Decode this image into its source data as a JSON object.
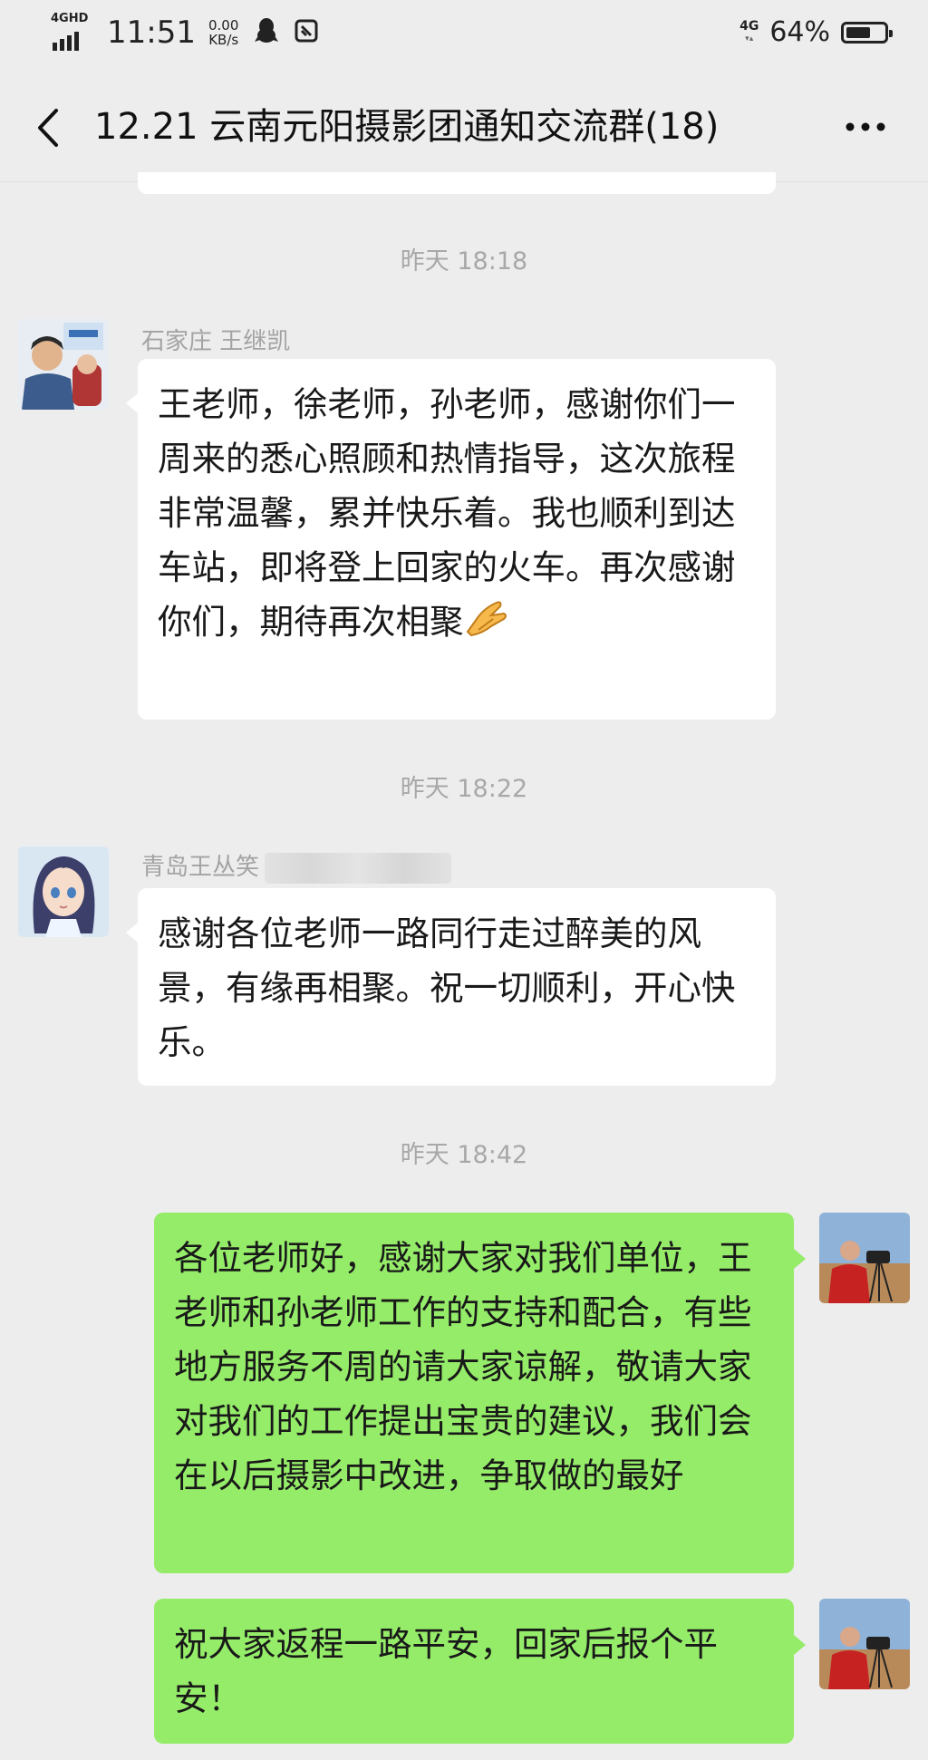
{
  "status_bar": {
    "network_label": "4GHD",
    "time": "11:51",
    "speed_value": "0.00",
    "speed_unit": "KB/s",
    "qq_icon": "qq-penguin-icon",
    "data_icon": "data-saver-icon",
    "net_type": "4G",
    "battery_percent": "64%",
    "battery_level": 0.64
  },
  "nav": {
    "back_icon": "chevron-left-icon",
    "title": "12.21 云南元阳摄影团通知交流群(18)",
    "more_icon": "more-dots-icon"
  },
  "messages": [
    {
      "timestamp": "昨天 18:18",
      "sender": "石家庄 王继凯",
      "side": "left",
      "text": "王老师，徐老师，孙老师，感谢你们一周来的悉心照顾和热情指导，这次旅程非常温馨，累并快乐着。我也顺利到达车站，即将登上回家的火车。再次感谢你们，期待再次相聚",
      "emoji": "folded-hands-icon"
    },
    {
      "timestamp": "昨天 18:22",
      "sender": "青岛王丛笑",
      "side": "left",
      "text": "感谢各位老师一路同行走过醉美的风景，有缘再相聚。祝一切顺利，开心快乐。"
    },
    {
      "timestamp": "昨天 18:42",
      "side": "right",
      "text": "各位老师好，感谢大家对我们单位，王老师和孙老师工作的支持和配合，有些地方服务不周的请大家谅解，敬请大家对我们的工作提出宝贵的建议，我们会在以后摄影中改进，争取做的最好"
    },
    {
      "side": "right",
      "text": "祝大家返程一路平安，回家后报个平安！"
    }
  ],
  "colors": {
    "background": "#ededed",
    "bubble_self": "#95ec69",
    "bubble_other": "#ffffff",
    "timestamp": "#a8a8a8"
  }
}
